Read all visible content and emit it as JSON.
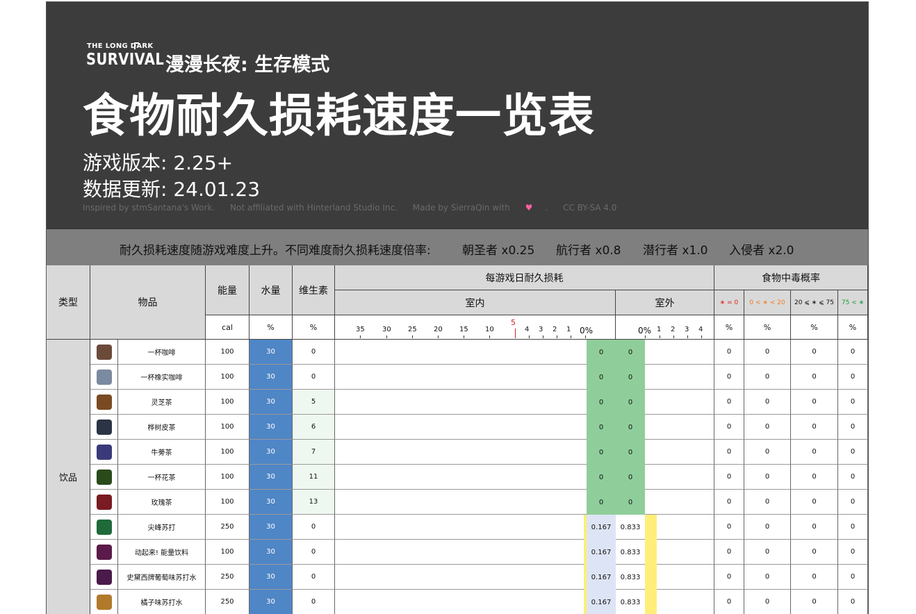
{
  "header": {
    "logo_small": "THE LONG DARK",
    "logo_big": "SURVIVAL",
    "subtitle": "漫漫长夜: 生存模式",
    "title": "食物耐久损耗速度一览表",
    "version": "游戏版本: 2.25+",
    "updated": "数据更新: 24.01.23",
    "credits": [
      "Inspired by stmSantana's Work.",
      "Not affiliated with Hinterland Studio Inc.",
      "Made by SierraQin with",
      "CC BY-SA 4.0"
    ]
  },
  "notice": {
    "text": "耐久损耗速度随游戏难度上升。不同难度耐久损耗速度倍率:",
    "modes": [
      "朝圣者 x0.25",
      "航行者 x0.8",
      "潜行者 x1.0",
      "入侵者 x2.0"
    ]
  },
  "columns": {
    "type": "类型",
    "item": "物品",
    "energy": "能量",
    "water": "水量",
    "vitamin": "维生素",
    "decay": "每游戏日耐久损耗",
    "indoor": "室内",
    "outdoor": "室外",
    "poison": "食物中毒概率",
    "poison_ranges": [
      "∗ = 0",
      "0 < ∗ < 20",
      "20 ⩽ ∗ ⩽ 75",
      "75 < ∗"
    ],
    "poison_colors": [
      "#e0211b",
      "#f07a1a",
      "#111111",
      "#1a9a3a"
    ],
    "units": {
      "energy": "cal",
      "water": "%",
      "vitamin": "%",
      "poison": "%"
    },
    "indoor_ticks": [
      "35",
      "30",
      "25",
      "20",
      "15",
      "10",
      "5",
      "4",
      "3",
      "2",
      "1",
      "0%"
    ],
    "outdoor_ticks": [
      "0%",
      "1",
      "2",
      "3",
      "4"
    ]
  },
  "category": "饮品",
  "items": [
    {
      "name": "一杯咖啡",
      "energy": "100",
      "water": "30",
      "vitamin": "0",
      "indoor": "0",
      "outdoor": "0",
      "poison": [
        "0",
        "0",
        "0",
        "0"
      ],
      "icon_color": "#6b4a3a"
    },
    {
      "name": "一杯橡实咖啡",
      "energy": "100",
      "water": "30",
      "vitamin": "0",
      "indoor": "0",
      "outdoor": "0",
      "poison": [
        "0",
        "0",
        "0",
        "0"
      ],
      "icon_color": "#7a8aa0"
    },
    {
      "name": "灵芝茶",
      "energy": "100",
      "water": "30",
      "vitamin": "5",
      "indoor": "0",
      "outdoor": "0",
      "poison": [
        "0",
        "0",
        "0",
        "0"
      ],
      "icon_color": "#7a4a22"
    },
    {
      "name": "桦树皮茶",
      "energy": "100",
      "water": "30",
      "vitamin": "6",
      "indoor": "0",
      "outdoor": "0",
      "poison": [
        "0",
        "0",
        "0",
        "0"
      ],
      "icon_color": "#2a3444"
    },
    {
      "name": "牛蒡茶",
      "energy": "100",
      "water": "30",
      "vitamin": "7",
      "indoor": "0",
      "outdoor": "0",
      "poison": [
        "0",
        "0",
        "0",
        "0"
      ],
      "icon_color": "#3a3a7a"
    },
    {
      "name": "一杯花茶",
      "energy": "100",
      "water": "30",
      "vitamin": "11",
      "indoor": "0",
      "outdoor": "0",
      "poison": [
        "0",
        "0",
        "0",
        "0"
      ],
      "icon_color": "#2a4a1a"
    },
    {
      "name": "玫瑰茶",
      "energy": "100",
      "water": "30",
      "vitamin": "13",
      "indoor": "0",
      "outdoor": "0",
      "poison": [
        "0",
        "0",
        "0",
        "0"
      ],
      "icon_color": "#7a1a22"
    },
    {
      "name": "尖峰苏打",
      "energy": "250",
      "water": "30",
      "vitamin": "0",
      "indoor": "0.167",
      "outdoor": "0.833",
      "poison": [
        "0",
        "0",
        "0",
        "0"
      ],
      "icon_color": "#1f6a3a"
    },
    {
      "name": "动起来! 能量饮料",
      "energy": "100",
      "water": "30",
      "vitamin": "0",
      "indoor": "0.167",
      "outdoor": "0.833",
      "poison": [
        "0",
        "0",
        "0",
        "0"
      ],
      "icon_color": "#5a1a4a"
    },
    {
      "name": "史黛西牌葡萄味苏打水",
      "energy": "250",
      "water": "30",
      "vitamin": "0",
      "indoor": "0.167",
      "outdoor": "0.833",
      "poison": [
        "0",
        "0",
        "0",
        "0"
      ],
      "icon_color": "#4a1a4a"
    },
    {
      "name": "橘子味苏打水",
      "energy": "250",
      "water": "30",
      "vitamin": "0",
      "indoor": "0.167",
      "outdoor": "0.833",
      "poison": [
        "0",
        "0",
        "0",
        "0"
      ],
      "icon_color": "#b07a2a"
    }
  ]
}
